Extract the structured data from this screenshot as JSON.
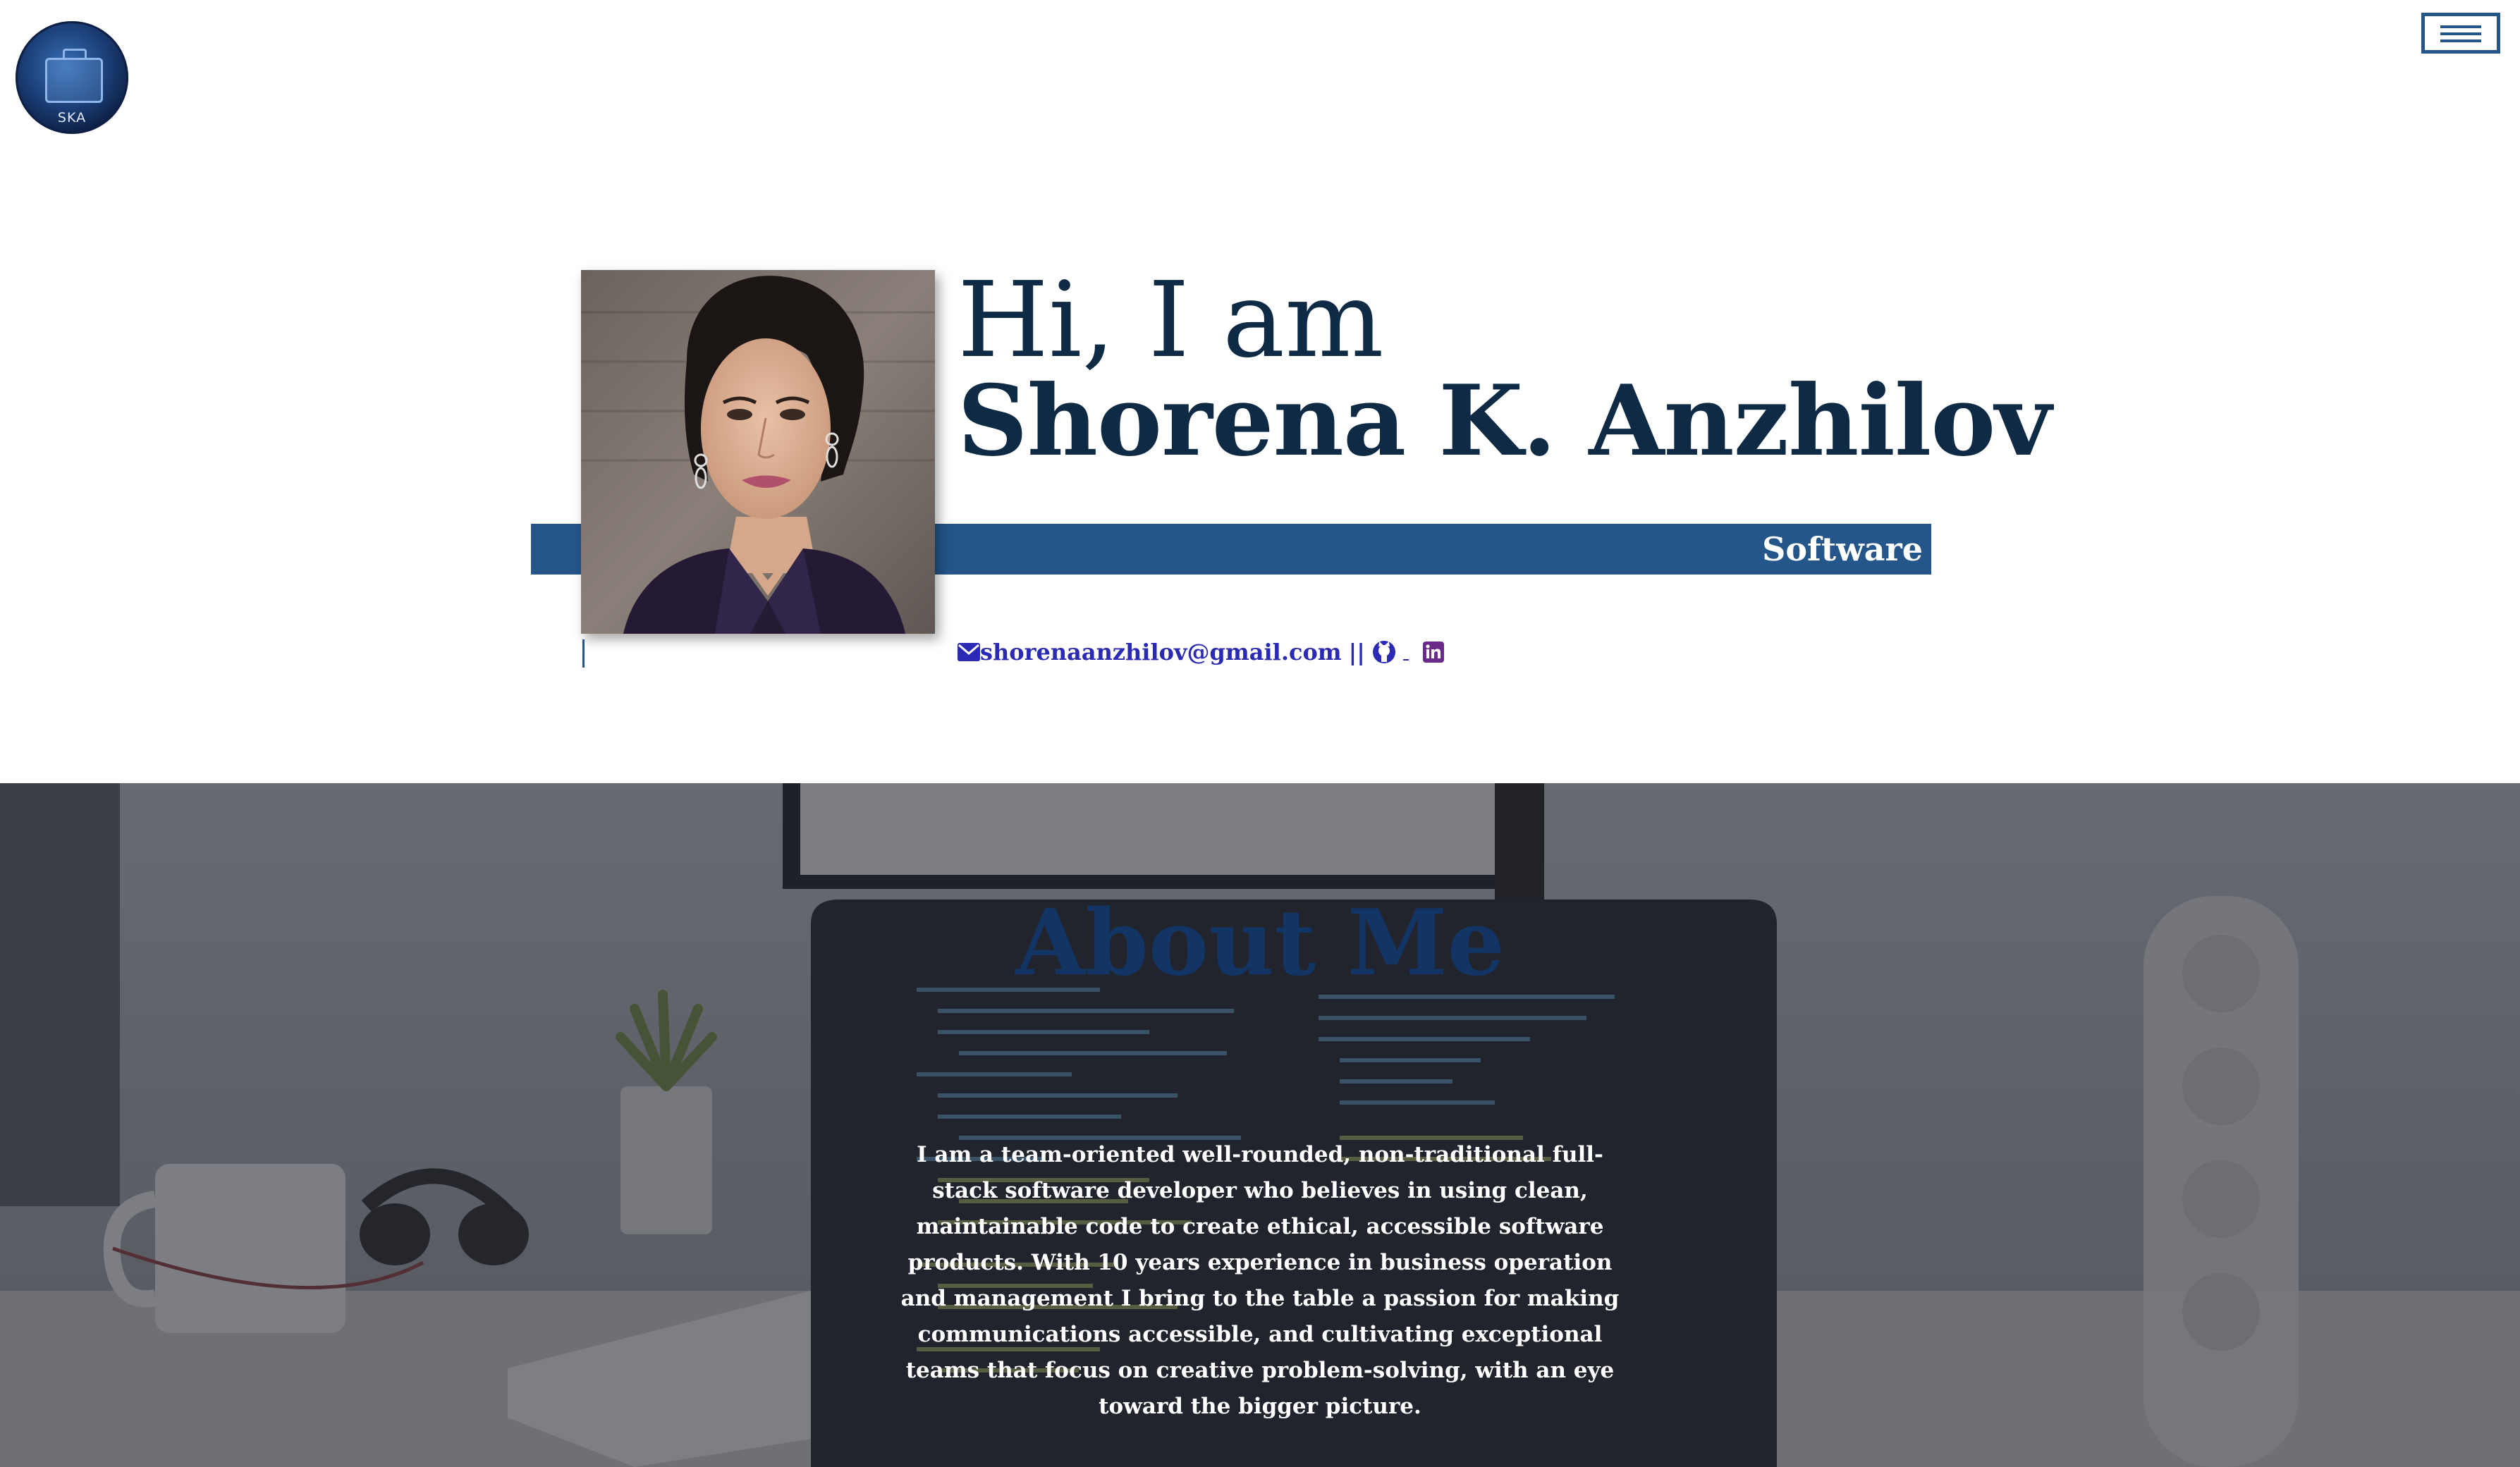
{
  "header": {
    "logo_text": "SKA",
    "menu_icon": "hamburger-menu-icon"
  },
  "hero": {
    "greeting": "Hi, I am",
    "name": "Shorena K. Anzhilov",
    "role": "Software",
    "email": "shorenaanzhilov@gmail.com",
    "separator": "||",
    "icons": [
      "envelope-icon",
      "github-icon",
      "linkedin-icon"
    ]
  },
  "about": {
    "title": "About Me",
    "text": "I am a team-oriented well-rounded, non-traditional full-stack software developer who believes in using clean, maintainable code to create ethical, accessible software products. With 10 years experience in business operation and management I bring to the table a passion for making communications accessible, and cultivating exceptional teams that focus on creative problem-solving, with an eye toward the bigger picture."
  },
  "colors": {
    "accent_blue": "#24568a",
    "heading_navy": "#0f2a44",
    "link_blue": "#2a2ab5",
    "about_title": "#123565"
  }
}
